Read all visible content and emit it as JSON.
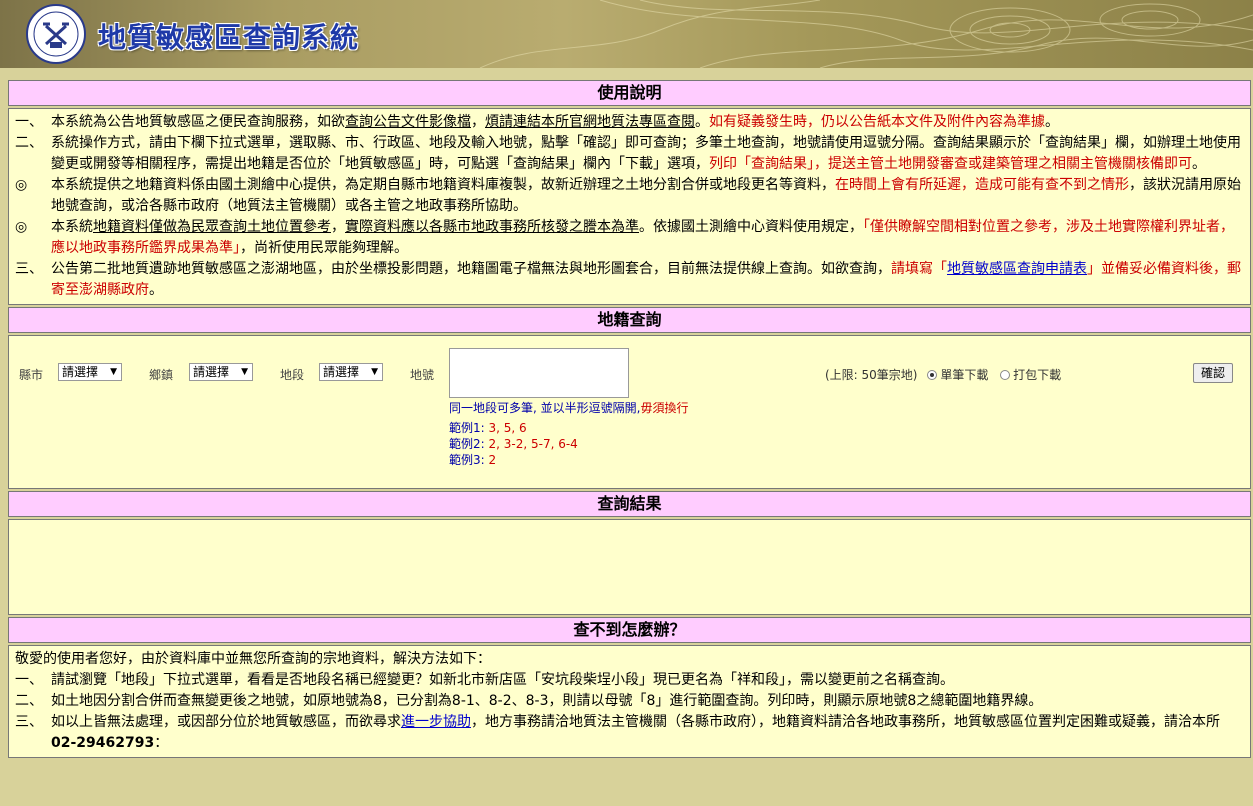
{
  "header": {
    "site_title": "地質敏感區查詢系統",
    "logo_icon": "agency-seal-icon"
  },
  "usage": {
    "title": "使用說明",
    "items": [
      {
        "marker": "一、",
        "parts": [
          {
            "t": "本系統為公告地質敏感區之便民查詢服務，如欲",
            "s": ""
          },
          {
            "t": "查詢公告文件影像檔",
            "s": "ul"
          },
          {
            "t": "，",
            "s": ""
          },
          {
            "t": "煩請連結本所官網地質法專區查閱",
            "s": "ul"
          },
          {
            "t": "。",
            "s": ""
          },
          {
            "t": "如有疑義發生時，仍以公告紙本文件及附件內容為準據",
            "s": "red"
          },
          {
            "t": "。",
            "s": ""
          }
        ]
      },
      {
        "marker": "二、",
        "parts": [
          {
            "t": "系統操作方式，請由下欄下拉式選單，選取縣、市、行政區、地段及輸入地號，點擊「確認」即可查詢；多筆土地查詢，地號請使用逗號分隔。查詢結果顯示於「查詢結果」欄，如辦理土地使用變更或開發等相關程序，需提出地籍是否位於「地質敏感區」時，可點選「查詢結果」欄內「下載」選項，",
            "s": ""
          },
          {
            "t": "列印「查詢結果」，提送主管土地開發審查或建築管理之相關主管機關核備即可",
            "s": "red"
          },
          {
            "t": "。",
            "s": ""
          }
        ]
      },
      {
        "marker": "◎",
        "parts": [
          {
            "t": "本系統提供之地籍資料係由國土測繪中心提供，為定期自縣市地籍資料庫複製，故新近辦理之土地分割合併或地段更名等資料，",
            "s": ""
          },
          {
            "t": "在時間上會有所延遲，造成可能有查不到之情形",
            "s": "red"
          },
          {
            "t": "，該狀況請用原始地號查詢，或洽各縣市政府（地質法主管機關）或各主管之地政事務所協助。",
            "s": ""
          }
        ]
      },
      {
        "marker": "◎",
        "parts": [
          {
            "t": "本系統",
            "s": ""
          },
          {
            "t": "地籍資料僅做為民眾查詢土地位置參考",
            "s": "ul"
          },
          {
            "t": "，",
            "s": ""
          },
          {
            "t": "實際資料應以各縣市地政事務所核發之謄本為準",
            "s": "ul"
          },
          {
            "t": "。依據國土測繪中心資料使用規定，",
            "s": ""
          },
          {
            "t": "「僅供瞭解空間相對位置之參考，涉及土地實際權利界址者，應以地政事務所鑑界成果為準」",
            "s": "red"
          },
          {
            "t": "，尚祈使用民眾能夠理解。",
            "s": ""
          }
        ]
      },
      {
        "marker": "三、",
        "parts": [
          {
            "t": "公告第二批地質遺跡地質敏感區之澎湖地區，由於坐標投影問題，地籍圖電子檔無法與地形圖套合，目前無法提供線上查詢。如欲查詢，",
            "s": ""
          },
          {
            "t": "請填寫「",
            "s": "red"
          },
          {
            "t": "地質敏感區查詢申請表",
            "s": "link"
          },
          {
            "t": "」並備妥必備資料後，郵寄至澎湖縣政府",
            "s": "red"
          },
          {
            "t": "。",
            "s": ""
          }
        ]
      }
    ]
  },
  "cadastre": {
    "title": "地籍查詢",
    "county_label": "縣市",
    "county_value": "請選擇",
    "township_label": "鄉鎮",
    "township_value": "請選擇",
    "section_label": "地段",
    "section_value": "請選擇",
    "parcel_label": "地號",
    "hint_blue": "同一地段可多筆, 並以半形逗號隔開,",
    "hint_red": "毋須換行",
    "examples": [
      {
        "label": "範例1: ",
        "value": "3, 5, 6"
      },
      {
        "label": "範例2: ",
        "value": "2, 3-2, 5-7, 6-4"
      },
      {
        "label": "範例3: ",
        "value": "2"
      }
    ],
    "limit_text": "(上限: 50筆宗地)",
    "single_download_label": "單筆下載",
    "bulk_download_label": "打包下載",
    "confirm_label": "確認"
  },
  "results": {
    "title": "查詢結果"
  },
  "help": {
    "title": "查不到怎麼辦？",
    "intro": "敬愛的使用者您好，由於資料庫中並無您所查詢的宗地資料，解決方法如下：",
    "items": [
      {
        "marker": "一、",
        "parts": [
          {
            "t": "請試瀏覽「地段」下拉式選單，看看是否地段名稱已經變更？如新北市新店區「安坑段柴埕小段」現已更名為「祥和段」，需以變更前之名稱查詢。",
            "s": ""
          }
        ]
      },
      {
        "marker": "二、",
        "parts": [
          {
            "t": "如土地因分割合併而查無變更後之地號，如原地號為8，已分割為8-1、8-2、8-3，則請以母號「8」進行範圍查詢。列印時，則顯示原地號8之總範圍地籍界線。",
            "s": ""
          }
        ]
      },
      {
        "marker": "三、",
        "parts": [
          {
            "t": "如以上皆無法處理，或因部分位於地質敏感區，而欲尋求",
            "s": ""
          },
          {
            "t": "進一步協助",
            "s": "link"
          },
          {
            "t": "，地方事務請洽地質法主管機關（各縣市政府），地籍資料請洽各地政事務所，地質敏感區位置判定困難或疑義，請洽本所 ",
            "s": ""
          },
          {
            "t": "02-29462793",
            "s": "bold"
          },
          {
            "t": "：",
            "s": ""
          }
        ]
      }
    ]
  }
}
